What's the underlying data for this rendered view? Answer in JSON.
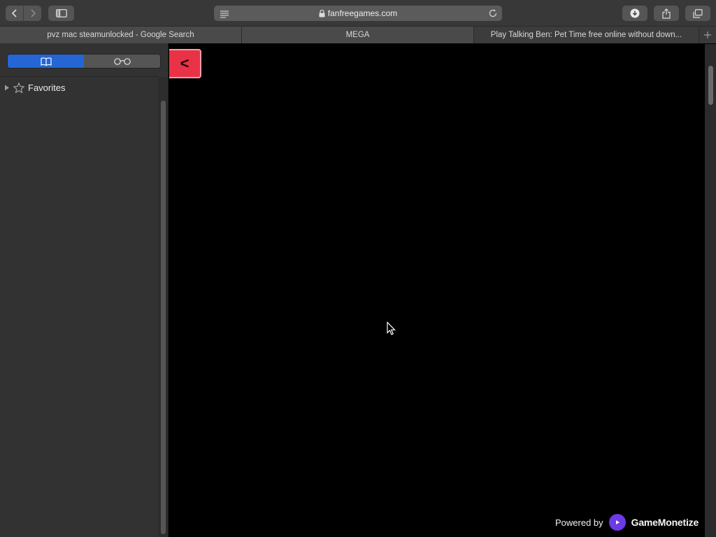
{
  "toolbar": {
    "url": "fanfreegames.com"
  },
  "tabs": [
    {
      "label": "pvz mac steamunlocked - Google Search"
    },
    {
      "label": "MEGA"
    },
    {
      "label": "Play Talking Ben: Pet Time free online without down..."
    }
  ],
  "sidebar": {
    "segments": [
      "bookmarks-icon",
      "reading-list-icon"
    ],
    "favorites_label": "Favorites"
  },
  "game": {
    "back_label": "<",
    "powered_by": "Powered by",
    "brand": "GameMonetize"
  },
  "colors": {
    "accent": "#2466d6",
    "back_tab": "#ea3247",
    "brand_purple": "#6c3ae6"
  }
}
